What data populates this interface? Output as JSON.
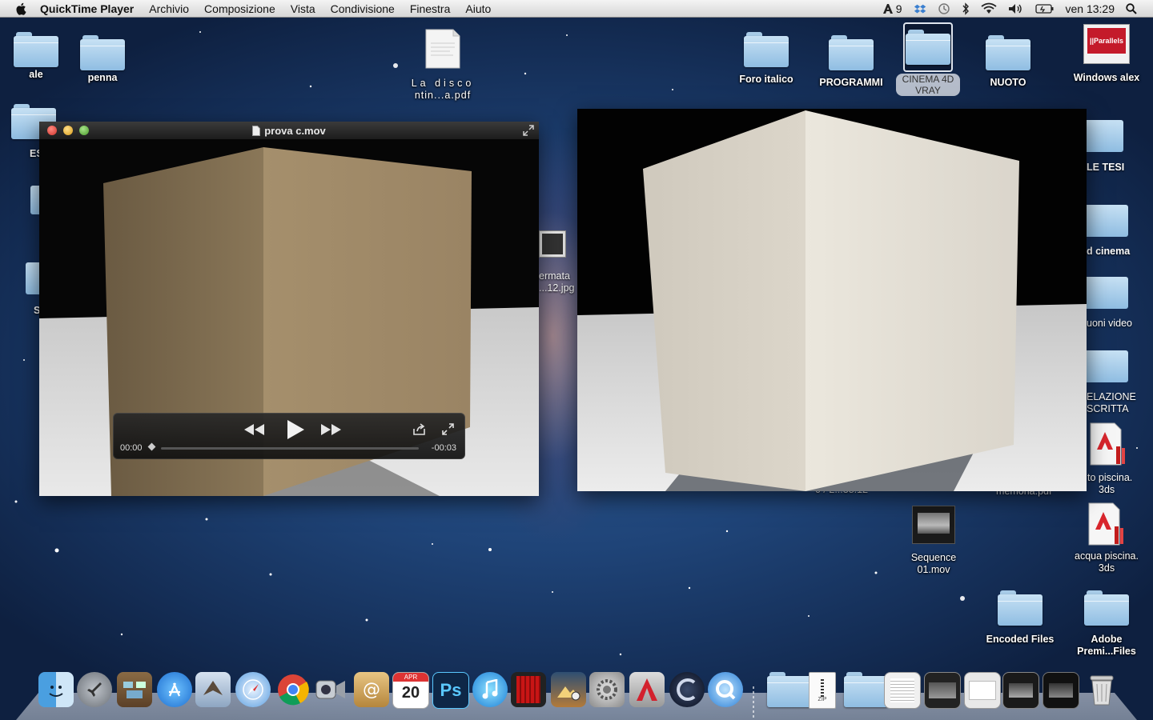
{
  "menubar": {
    "app_name": "QuickTime Player",
    "items": [
      "Archivio",
      "Composizione",
      "Vista",
      "Condivisione",
      "Finestra",
      "Aiuto"
    ],
    "status": {
      "input_menu_count": "9",
      "clock": "ven 13:29"
    }
  },
  "desktop": {
    "icons": {
      "ale": "ale",
      "penna": "penna",
      "pdf_line1": "La disco",
      "pdf_line2": "ntin...a.pdf",
      "foro": "Foro italico",
      "programmi": "PROGRAMMI",
      "cinema_line1": "CINEMA 4D",
      "cinema_line2": "VRAY",
      "nuoto": "NUOTO",
      "windows": "Windows alex",
      "parallels_logo": "||Parallels",
      "tesi": "LE TESI",
      "cinema2": "d cinema",
      "video": "uoni video",
      "relazione_line1": "ELAZIONE",
      "relazione_line2": "SCRITTA",
      "piscina1_line1": "to piscina.",
      "piscina1_line2": "3ds",
      "sequence_line1": "Sequence",
      "sequence_line2": "01.mov",
      "piscina2_line1": "acqua piscina.",
      "piscina2_line2": "3ds",
      "encoded": "Encoded Files",
      "adobe_line1": "Adobe",
      "adobe_line2": "Premi...Files",
      "ermata_line1": "ermata",
      "ermata_line2": "...12.jpg",
      "es_partial": "ES",
      "s_partial": "S",
      "hidden_partial1": "0 / 2...38.12",
      "hidden_partial2": "memoria.pdf"
    }
  },
  "qt_window": {
    "title": "prova c.mov",
    "elapsed": "00:00",
    "remaining": "-00:03",
    "progress": 0
  },
  "dock": {
    "calendar_month": "APR",
    "calendar_day": "20",
    "ps_label": "Ps",
    "zip_label": "ZIP"
  },
  "colors": {
    "selection": "#d2d7e1",
    "folder_light": "#c7e1f4",
    "folder_dark": "#8fbde2"
  }
}
